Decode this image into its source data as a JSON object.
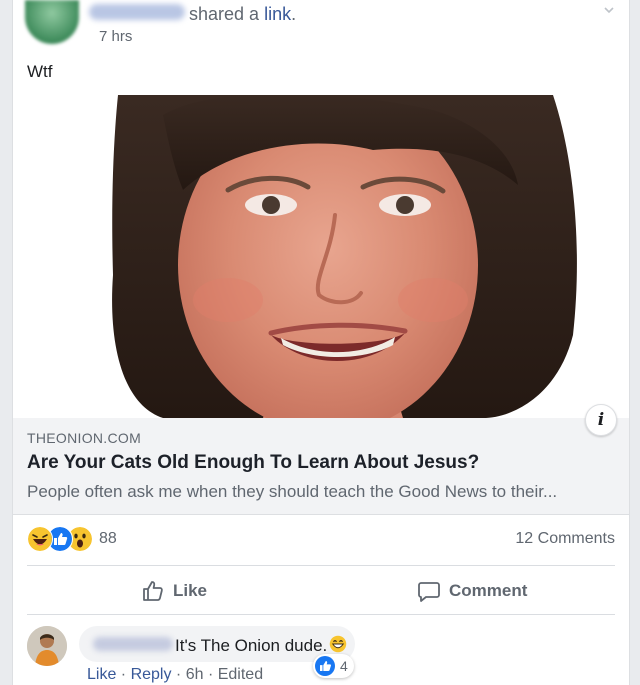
{
  "post": {
    "action_text": "shared a",
    "action_link": "link",
    "action_end": ".",
    "time": "7 hrs",
    "message": "Wtf"
  },
  "link_preview": {
    "domain": "THEONION.COM",
    "title": "Are Your Cats Old Enough To Learn About Jesus?",
    "description": "People often ask me when they should teach the Good News to their...",
    "info_label": "i"
  },
  "stats": {
    "reaction_count": "88",
    "comments_count": "12 Comments",
    "reactions": [
      "haha",
      "like",
      "wow"
    ]
  },
  "actions": {
    "like_label": "Like",
    "comment_label": "Comment"
  },
  "comment": {
    "text": "It's The Onion dude.",
    "like_count": "4",
    "like_link": "Like",
    "dot1": " · ",
    "reply_link": "Reply",
    "dot2": " · ",
    "time": "6h",
    "dot3": " · ",
    "edited": "Edited"
  },
  "colors": {
    "brand_blue": "#385898",
    "like_blue": "#1877f2",
    "reaction_yellow": "#f7c42f"
  }
}
